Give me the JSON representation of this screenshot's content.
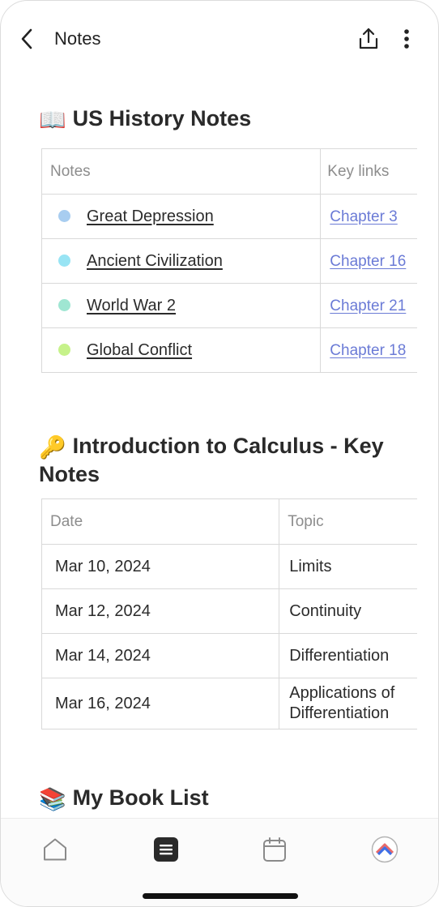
{
  "header": {
    "title": "Notes"
  },
  "sections": {
    "us_history": {
      "emoji": "📖",
      "title": "US History Notes",
      "columns": [
        "Notes",
        "Key links"
      ],
      "rows": [
        {
          "note": "Great Depression",
          "link": "Chapter 3",
          "color": "#a8cdf0"
        },
        {
          "note": "Ancient Civilization",
          "link": "Chapter 16",
          "color": "#98e4f4"
        },
        {
          "note": "World War 2",
          "link": "Chapter 21",
          "color": "#9fe6d2"
        },
        {
          "note": "Global Conflict",
          "link": "Chapter 18",
          "color": "#c6f28a"
        }
      ]
    },
    "calculus": {
      "emoji": "🔑",
      "title": "Introduction to Calculus - Key Notes",
      "columns": [
        "Date",
        "Topic"
      ],
      "rows": [
        {
          "date": "Mar 10, 2024",
          "topic": "Limits"
        },
        {
          "date": "Mar 12, 2024",
          "topic": "Continuity"
        },
        {
          "date": "Mar 14, 2024",
          "topic": "Differentiation"
        },
        {
          "date": "Mar 16, 2024",
          "topic": "Applications of Differentiation"
        }
      ]
    },
    "book_list": {
      "emoji": "📚",
      "title": "My Book List"
    }
  },
  "bottom_nav": {
    "items": [
      "home-icon",
      "notes-icon",
      "calendar-icon",
      "profile-avatar-icon"
    ],
    "active": "notes-icon"
  },
  "colors": {
    "link": "#6b7bd6",
    "border": "#d9d9d9",
    "header_text": "#8d8d8d"
  }
}
